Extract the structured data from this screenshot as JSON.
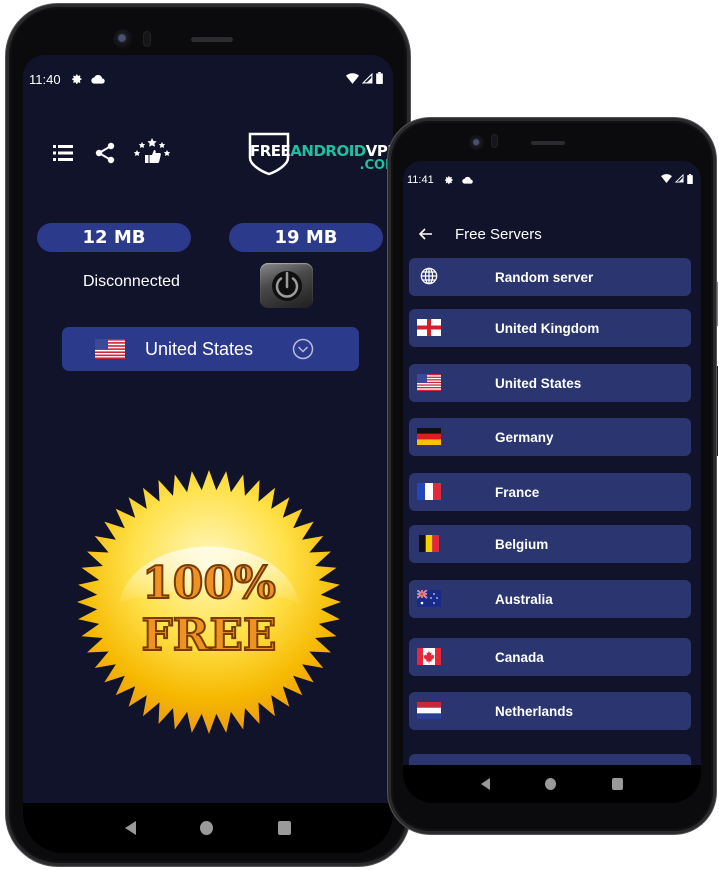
{
  "left_phone": {
    "status_bar": {
      "time": "11:40",
      "icons": [
        "gear-icon",
        "cloud-icon",
        "wifi-icon",
        "signal-icon",
        "battery-icon"
      ]
    },
    "toolbar": {
      "icons": [
        "list-icon",
        "share-icon",
        "rate-stars-icon"
      ],
      "logo": {
        "part1": "FREE",
        "part2": "ANDROID",
        "part3": "VPN",
        "suffix": ".COM"
      }
    },
    "stats": {
      "download": "12 MB",
      "upload": "19 MB"
    },
    "connection_status": "Disconnected",
    "selected_country": {
      "name": "United States",
      "flag": "us"
    },
    "badge": {
      "line1": "100%",
      "line2": "FREE"
    }
  },
  "right_phone": {
    "status_bar": {
      "time": "11:41",
      "icons": [
        "gear-icon",
        "cloud-icon",
        "wifi-icon",
        "signal-icon",
        "battery-icon"
      ]
    },
    "header": {
      "title": "Free Servers"
    },
    "servers": [
      {
        "name": "Random server",
        "flag": "globe"
      },
      {
        "name": "United Kingdom",
        "flag": "uk"
      },
      {
        "name": "United States",
        "flag": "us"
      },
      {
        "name": "Germany",
        "flag": "de"
      },
      {
        "name": "France",
        "flag": "fr"
      },
      {
        "name": "Belgium",
        "flag": "be"
      },
      {
        "name": "Australia",
        "flag": "au"
      },
      {
        "name": "Canada",
        "flag": "ca"
      },
      {
        "name": "Netherlands",
        "flag": "nl"
      },
      {
        "name": "",
        "flag": ""
      }
    ]
  },
  "colors": {
    "screen_bg": "#11132a",
    "pill_bg": "#2b3a8a",
    "list_item_bg": "#2b3670",
    "logo_accent": "#1fbfa0",
    "badge_gold": "#f5c400",
    "badge_text": "#e8901c"
  }
}
